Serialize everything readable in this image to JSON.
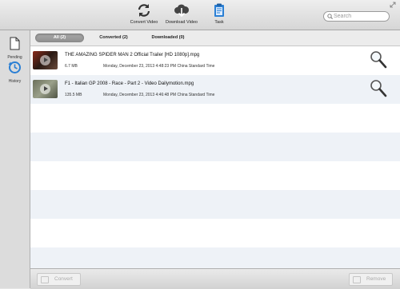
{
  "toolbar": {
    "convert_label": "Convert Video",
    "download_label": "Download Video",
    "task_label": "Task"
  },
  "search": {
    "placeholder": "Search"
  },
  "sidebar": {
    "items": [
      {
        "label": "Pending",
        "icon": "document-icon"
      },
      {
        "label": "History",
        "icon": "history-clock-icon"
      }
    ]
  },
  "tabs": [
    {
      "label": "All (2)",
      "active": true
    },
    {
      "label": "Converted (2)",
      "active": false
    },
    {
      "label": "Downloaded (0)",
      "active": false
    }
  ],
  "files": [
    {
      "name": "THE AMAZING SPIDER MAN 2 Official Trailer [HD 1080p].mpg",
      "size": "6.7 MB",
      "date": "Monday, December 23, 2013 4:48:23 PM China Standard Time"
    },
    {
      "name": "F1 - Italian GP 2008 - Race - Part 2 - Video Dailymotion.mpg",
      "size": "135.5 MB",
      "date": "Monday, December 23, 2013 4:46:48 PM China Standard Time"
    }
  ],
  "bottom": {
    "convert_label": "Convert",
    "remove_label": "Remove"
  },
  "colors": {
    "accent": "#2a7fd4",
    "tab_active": "#9b9b9b",
    "row_alt": "#eef2f7"
  }
}
